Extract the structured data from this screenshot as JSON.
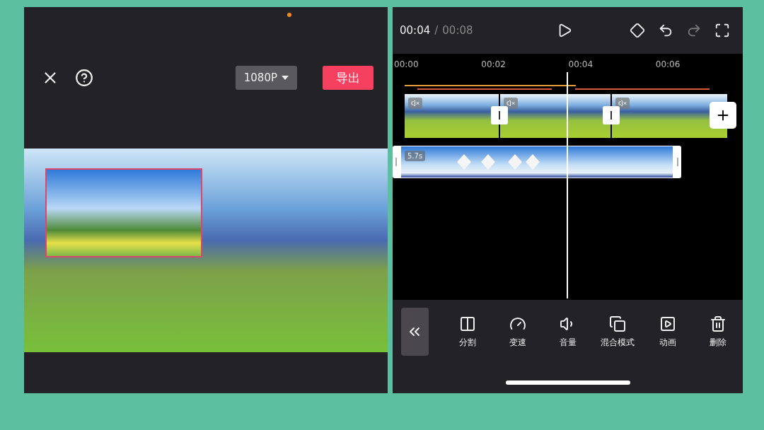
{
  "export_screen": {
    "resolution": "1080P",
    "export_button": "导出"
  },
  "editor": {
    "current_time": "00:04",
    "total_time": "00:08",
    "separator": "/",
    "ruler": [
      "00:00",
      "00:02",
      "00:04",
      "00:06"
    ],
    "main_track": {
      "clips": [
        {
          "muted": true
        },
        {
          "muted": true
        },
        {
          "muted": true
        }
      ]
    },
    "overlay_track": {
      "duration": "5.7s"
    },
    "tools": [
      {
        "label": "分割",
        "kind": "split"
      },
      {
        "label": "变速",
        "kind": "speed"
      },
      {
        "label": "音量",
        "kind": "volume"
      },
      {
        "label": "混合模式",
        "kind": "blend"
      },
      {
        "label": "动画",
        "kind": "animation"
      },
      {
        "label": "删除",
        "kind": "delete"
      }
    ]
  }
}
